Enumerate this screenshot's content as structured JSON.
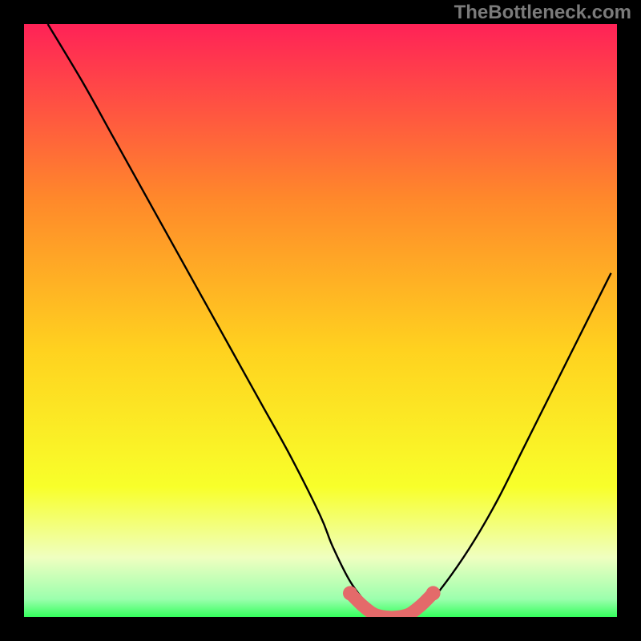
{
  "watermark": "TheBottleneck.com",
  "colors": {
    "bg_black": "#000000",
    "grad_top": "#ff2257",
    "grad_mid1": "#ff6a3a",
    "grad_mid2": "#ffd21f",
    "grad_mid3": "#f8ff2a",
    "grad_bot_yellow": "#f3ffb0",
    "grad_green": "#35ff5d",
    "curve": "#000000",
    "marker": "#e46a6a"
  },
  "chart_data": {
    "type": "line",
    "title": "",
    "xlabel": "",
    "ylabel": "",
    "xlim": [
      0,
      100
    ],
    "ylim": [
      0,
      100
    ],
    "series": [
      {
        "name": "bottleneck-curve",
        "x": [
          4,
          10,
          15,
          20,
          25,
          30,
          35,
          40,
          45,
          50,
          52,
          55,
          58,
          60,
          62,
          65,
          68,
          72,
          76,
          80,
          84,
          88,
          92,
          96,
          99
        ],
        "y": [
          100,
          90,
          81,
          72,
          63,
          54,
          45,
          36,
          27,
          17,
          12,
          6,
          2,
          0,
          0,
          0,
          2,
          7,
          13,
          20,
          28,
          36,
          44,
          52,
          58
        ]
      }
    ],
    "markers": {
      "name": "highlight-segment",
      "x": [
        55,
        57,
        59,
        61,
        63,
        65,
        67,
        69
      ],
      "y": [
        4,
        2,
        0.5,
        0,
        0,
        0.5,
        2,
        4
      ]
    }
  }
}
